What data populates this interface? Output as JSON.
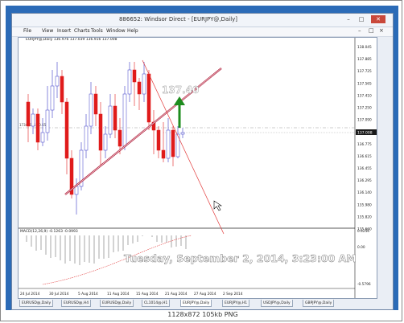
{
  "viewer": {
    "caption": "1128x872 105kb PNG"
  },
  "window": {
    "title": "886652: Windsor Direct - [EURJPY@,Daily]",
    "buttons": {
      "minimize": "–",
      "maximize": "□",
      "close": "✕"
    }
  },
  "menu": {
    "items": [
      "File",
      "View",
      "Insert",
      "Charts",
      "Tools",
      "Window",
      "Help"
    ],
    "right_controls": [
      "–",
      "□",
      "×"
    ]
  },
  "chart": {
    "header": "EURJPY@,Daily  136.976 137.039 136.916 137.008",
    "side_label": "17347051 : 0.65",
    "price_annotation": "137.40",
    "timestamp_overlay": "Tuesday, September 2, 2014, 3:23:00 AM",
    "indicator_label": "MACD(12,26,9)  -0.1263  -0.0993",
    "price_axis": [
      "138.045",
      "137.885",
      "137.725",
      "137.565",
      "137.410",
      "137.250",
      "137.090",
      "136.935",
      "136.775",
      "136.615",
      "136.455",
      "136.295",
      "136.140",
      "135.980",
      "135.820",
      "135.660"
    ],
    "current_price": "137.008",
    "macd_axis": [
      "0.4256",
      "0.00",
      "-0.5796"
    ],
    "dates": [
      "24 Jul 2014",
      "30 Jul 2014",
      "5 Aug 2014",
      "11 Aug 2014",
      "15 Aug 2014",
      "21 Aug 2014",
      "27 Aug 2014",
      "2 Sep 2014"
    ],
    "colors": {
      "bull": "#3a3ac8",
      "bear": "#e01b1b",
      "trendline": "#b01f3b",
      "arrow": "#1e8c1e",
      "overlay_text": "#ffffff"
    }
  },
  "tabs": [
    "EURUSD@,Daily",
    "EURUSD@,H4",
    "EURUSD@,Daily",
    "CL1014@,H1",
    "EURJPY@,Daily",
    "EURJPY@,H1",
    "USDJPY@,Daily",
    "GBPJPY@,Daily"
  ],
  "active_tab_index": 4
}
